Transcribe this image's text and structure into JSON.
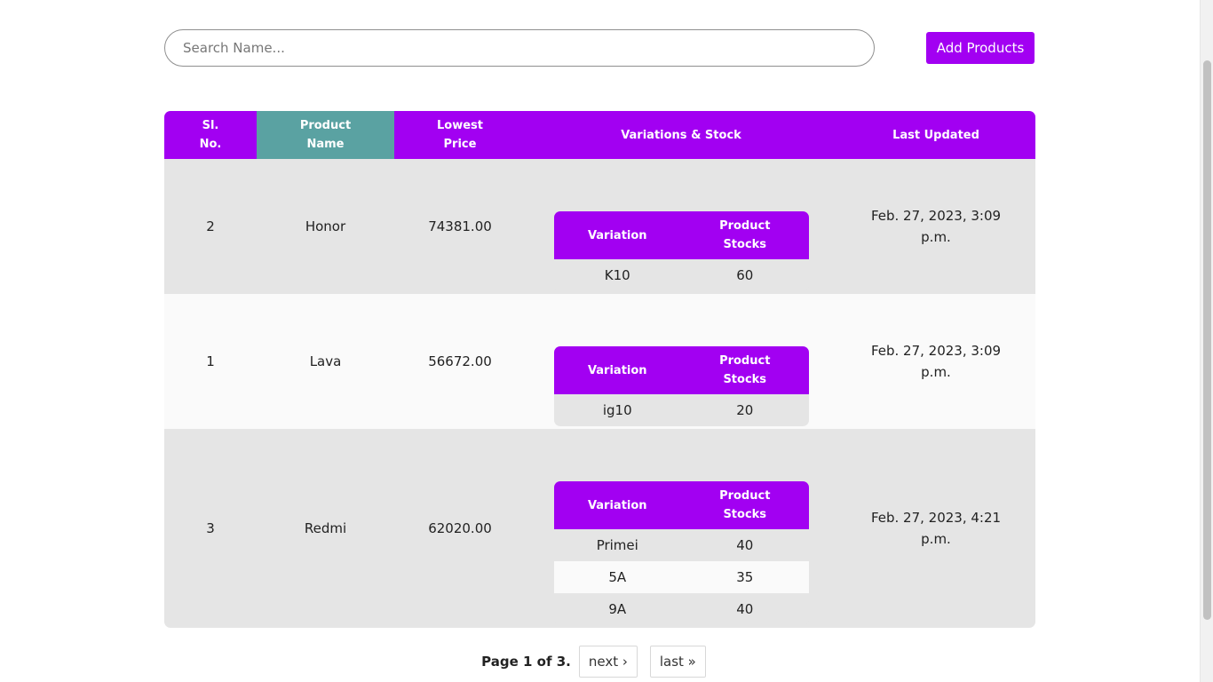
{
  "search": {
    "placeholder": "Search Name..."
  },
  "toolbar": {
    "add_label": "Add Products"
  },
  "table": {
    "headers": {
      "sl_no": "Sl. No.",
      "product_name": "Product Name",
      "lowest_price": "Lowest Price",
      "variations": "Variations & Stock",
      "last_updated": "Last Updated"
    },
    "variation_headers": {
      "variation": "Variation",
      "stocks": "Product Stocks"
    },
    "rows": [
      {
        "sl": "2",
        "name": "Honor",
        "price": "74381.00",
        "updated": "Feb. 27, 2023, 3:09 p.m.",
        "variations": [
          {
            "name": "K10",
            "stock": "60"
          }
        ]
      },
      {
        "sl": "1",
        "name": "Lava",
        "price": "56672.00",
        "updated": "Feb. 27, 2023, 3:09 p.m.",
        "variations": [
          {
            "name": "ig10",
            "stock": "20"
          }
        ]
      },
      {
        "sl": "3",
        "name": "Redmi",
        "price": "62020.00",
        "updated": "Feb. 27, 2023, 4:21 p.m.",
        "variations": [
          {
            "name": "Primei",
            "stock": "40"
          },
          {
            "name": "5A",
            "stock": "35"
          },
          {
            "name": "9A",
            "stock": "40"
          }
        ]
      }
    ]
  },
  "pagination": {
    "info": "Page 1 of 3.",
    "next": "next ›",
    "last": "last »"
  },
  "colors": {
    "accent": "#a200f2",
    "sorted_header": "#5aa2a2",
    "row_grey": "#e5e5e5",
    "row_light": "#fafafa"
  }
}
